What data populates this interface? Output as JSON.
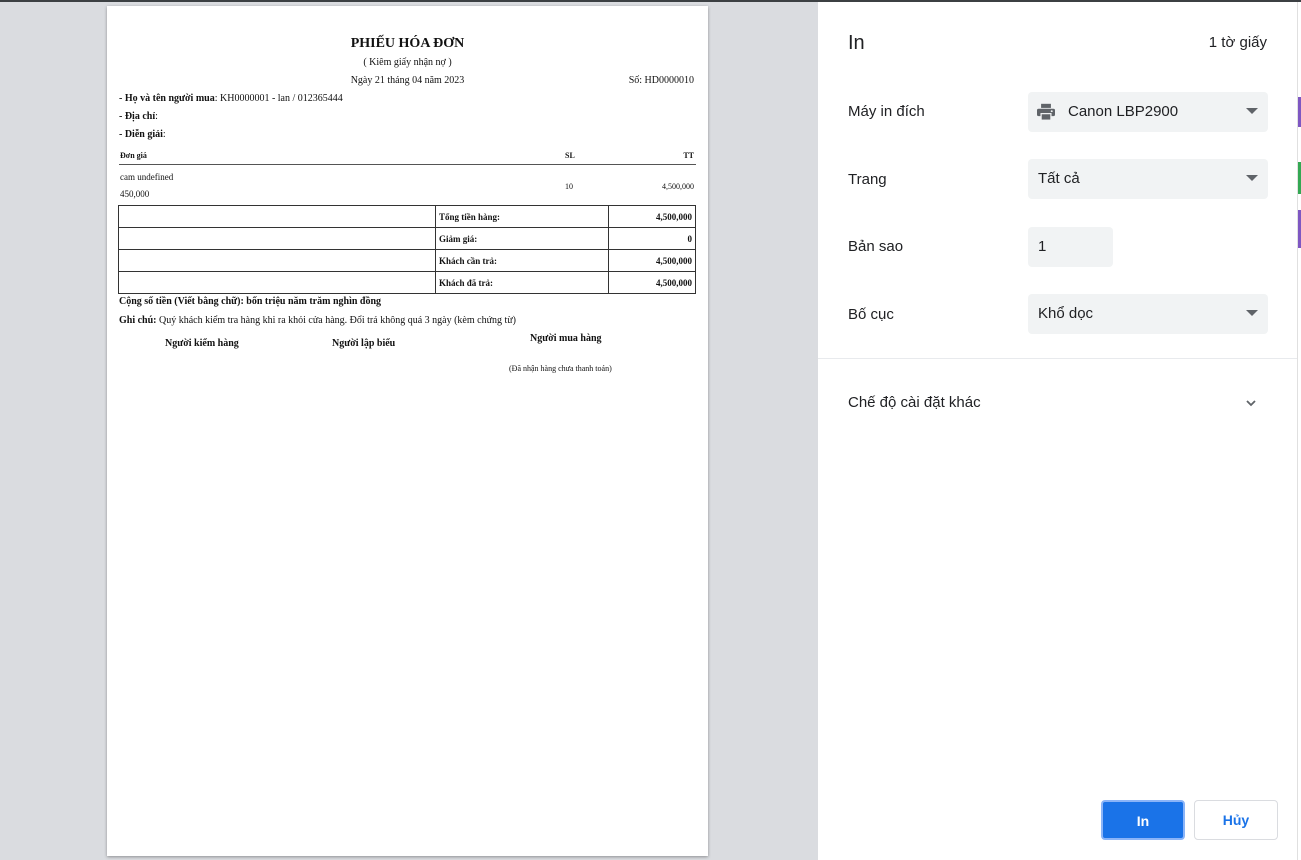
{
  "invoice": {
    "title": "PHIẾU HÓA ĐƠN",
    "subtitle": "( Kiêm giấy nhận nợ )",
    "date": "Ngày 21 tháng 04 năm 2023",
    "number": "Số: HD0000010",
    "buyer_label": "- Họ và tên người mua",
    "buyer_value": ": KH0000001 - lan / 012365444",
    "address_label": "- Địa chỉ",
    "address_value": ":",
    "desc_label": "- Diễn giải",
    "desc_value": ":",
    "columns": {
      "price": "Đơn giá",
      "qty": "SL",
      "total": "TT"
    },
    "items": [
      {
        "name": "cam undefined",
        "price": "450,000",
        "qty": "10",
        "total": "4,500,000"
      }
    ],
    "totals": [
      {
        "label": "Tổng tiền hàng:",
        "value": "4,500,000"
      },
      {
        "label": "Giảm giá:",
        "value": "0"
      },
      {
        "label": "Khách cần trả:",
        "value": "4,500,000"
      },
      {
        "label": "Khách đã trả:",
        "value": "4,500,000"
      }
    ],
    "amount_words": "Cộng số tiền (Viết bằng chữ): bốn triệu năm trăm nghìn đồng",
    "note_label": "Ghi chú:",
    "note_text": " Quý khách kiểm tra hàng khi ra khỏi cửa hàng. Đổi trả không quá 3 ngày (kèm chứng từ)",
    "sig_checker": "Người kiểm hàng",
    "sig_maker": "Người lập biểu",
    "sig_buyer": "Người mua hàng",
    "sig_buyer_note": "(Đã nhận hàng chưa thanh toán)"
  },
  "panel": {
    "title": "In",
    "sheets": "1 tờ giấy",
    "destination_label": "Máy in đích",
    "destination_value": "Canon LBP2900",
    "pages_label": "Trang",
    "pages_value": "Tất cả",
    "copies_label": "Bản sao",
    "copies_value": "1",
    "layout_label": "Bố cục",
    "layout_value": "Khổ dọc",
    "more_settings": "Chế độ cài đặt khác",
    "print_button": "In",
    "cancel_button": "Hủy"
  },
  "colors": {
    "accent": "#1a73e8",
    "panel_bg": "#ffffff",
    "field_bg": "#f1f3f4",
    "preview_bg": "#dadce0"
  },
  "icons": {
    "printer": "printer-icon",
    "dropdown": "chevron-down-icon"
  }
}
